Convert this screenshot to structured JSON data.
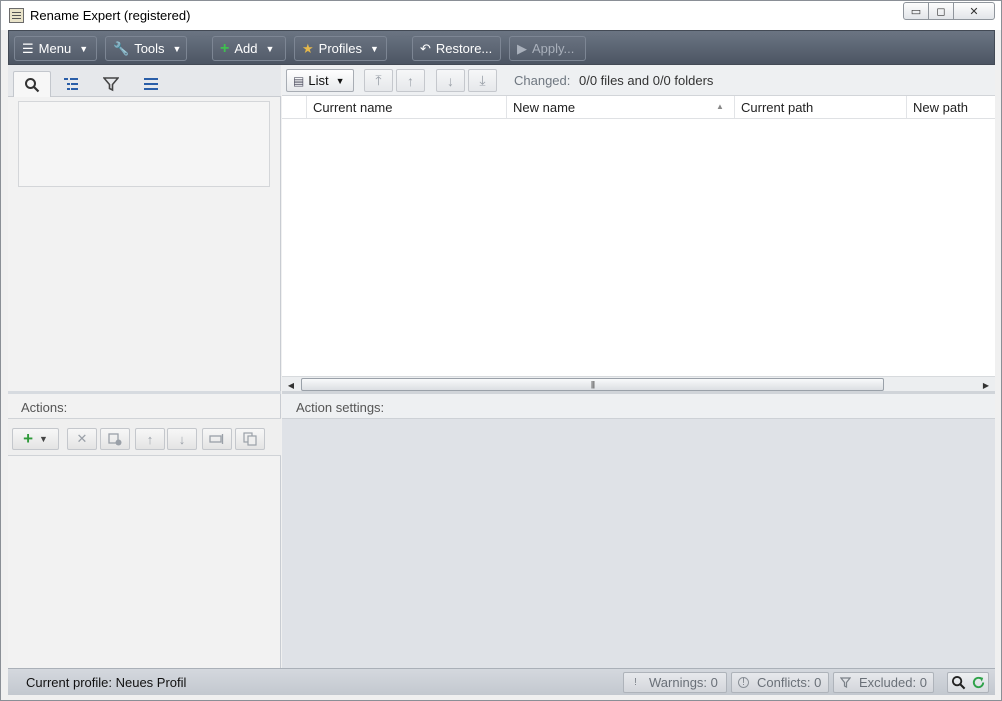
{
  "window": {
    "title": "Rename Expert (registered)",
    "controls": {
      "minimize": "▭",
      "restore": "◻",
      "close": "✕"
    }
  },
  "toolbar": {
    "menu_label": "Menu",
    "tools_label": "Tools",
    "add_label": "Add",
    "profiles_label": "Profiles",
    "restore_label": "Restore...",
    "apply_label": "Apply..."
  },
  "left_tabs": [
    {
      "icon": "search-icon"
    },
    {
      "icon": "tree-list-icon"
    },
    {
      "icon": "filter-icon"
    },
    {
      "icon": "list-icon"
    }
  ],
  "actions": {
    "label": "Actions:"
  },
  "file_list": {
    "view_label": "List",
    "changed_label": "Changed:",
    "changed_value": "0/0 files and 0/0 folders",
    "columns": [
      "Current name",
      "New name",
      "Current path",
      "New path"
    ]
  },
  "settings": {
    "label": "Action settings:"
  },
  "status": {
    "profile": "Current profile: Neues Profil",
    "warnings": "Warnings: 0",
    "conflicts": "Conflicts: 0",
    "excluded": "Excluded: 0"
  },
  "colors": {
    "toolbar_bg": "#545d6b",
    "settings_bg": "#dfe2e7",
    "add_green": "#2f9a3a",
    "star_gold": "#e5b84b"
  }
}
